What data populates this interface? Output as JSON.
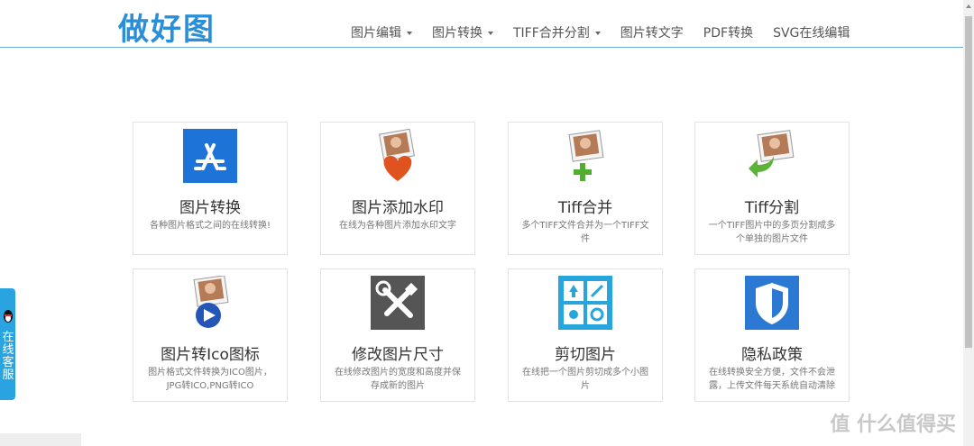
{
  "logo": "做好图",
  "nav": [
    {
      "label": "图片编辑",
      "dropdown": true
    },
    {
      "label": "图片转换",
      "dropdown": true
    },
    {
      "label": "TIFF合并分割",
      "dropdown": true
    },
    {
      "label": "图片转文字",
      "dropdown": false
    },
    {
      "label": "PDF转换",
      "dropdown": false
    },
    {
      "label": "SVG在线编辑",
      "dropdown": false
    }
  ],
  "cards": [
    {
      "title": "图片转换",
      "desc": "各种图片格式之间的在线转换!",
      "icon": "app-store-icon"
    },
    {
      "title": "图片添加水印",
      "desc": "在线为各种图片添加水印文字",
      "icon": "photo-heart-icon"
    },
    {
      "title": "Tiff合并",
      "desc": "多个TIFF文件合并为一个TIFF文件",
      "icon": "photo-plus-icon"
    },
    {
      "title": "Tiff分割",
      "desc": "一个TIFF图片中的多页分割成多个单独的图片文件",
      "icon": "photo-arrow-icon"
    },
    {
      "title": "图片转Ico图标",
      "desc": "图片格式文件转换为ICO图片，JPG转ICO,PNG转ICO",
      "icon": "photo-play-icon"
    },
    {
      "title": "修改图片尺寸",
      "desc": "在线修改图片的宽度和高度并保存成新的图片",
      "icon": "tools-icon"
    },
    {
      "title": "剪切图片",
      "desc": "在线把一个图片剪切成多个小图片",
      "icon": "cut-grid-icon"
    },
    {
      "title": "隐私政策",
      "desc": "在线转换安全方便，文件不会泄露，上传文件每天系统自动清除",
      "icon": "shield-icon"
    }
  ],
  "side_tab": "在线客服",
  "watermark": "值 什么值得买",
  "colors": {
    "accent": "#2a8fd8",
    "tab": "#2aa4e0",
    "header_line": "#6fb0d8"
  }
}
